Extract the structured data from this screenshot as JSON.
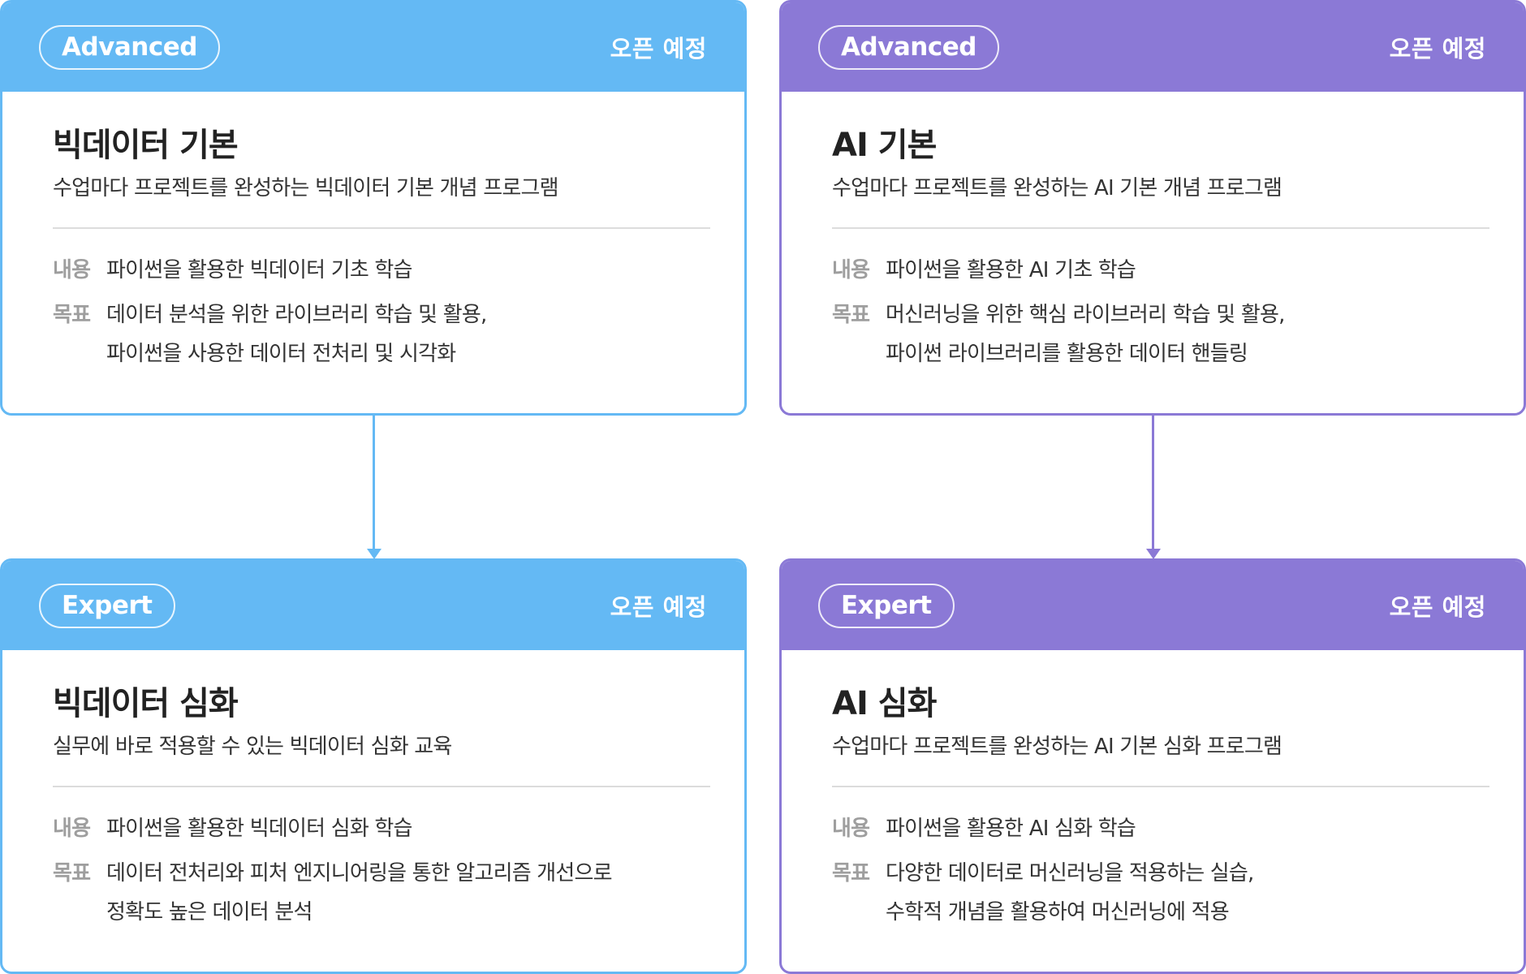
{
  "colors": {
    "bigdata_accent": "#64B9F4",
    "ai_accent": "#8B79D6",
    "label_gray": "#9E9E9E",
    "divider": "#DCDCDC"
  },
  "labels": {
    "content": "내용",
    "goal": "목표"
  },
  "cards": [
    {
      "level": "Advanced",
      "status": "오픈 예정",
      "title": "빅데이터 기본",
      "description": "수업마다 프로젝트를 완성하는 빅데이터 기본 개념 프로그램",
      "content": "파이썬을 활용한 빅데이터 기초 학습",
      "goal_lines": [
        "데이터 분석을 위한 라이브러리 학습 및 활용,",
        "파이썬을 사용한 데이터 전처리 및 시각화"
      ]
    },
    {
      "level": "Advanced",
      "status": "오픈 예정",
      "title": "AI 기본",
      "description": "수업마다 프로젝트를 완성하는 AI 기본 개념 프로그램",
      "content": "파이썬을 활용한 AI 기초 학습",
      "goal_lines": [
        "머신러닝을 위한 핵심 라이브러리 학습 및 활용,",
        "파이썬 라이브러리를 활용한 데이터 핸들링"
      ]
    },
    {
      "level": "Expert",
      "status": "오픈 예정",
      "title": "빅데이터 심화",
      "description": "실무에 바로 적용할 수 있는 빅데이터 심화 교육",
      "content": "파이썬을 활용한 빅데이터 심화 학습",
      "goal_lines": [
        "데이터 전처리와 피처 엔지니어링을 통한 알고리즘 개선으로",
        "정확도 높은 데이터 분석"
      ]
    },
    {
      "level": "Expert",
      "status": "오픈 예정",
      "title": "AI 심화",
      "description": "수업마다 프로젝트를 완성하는 AI 기본 심화 프로그램",
      "content": "파이썬을 활용한 AI 심화 학습",
      "goal_lines": [
        "다양한 데이터로 머신러닝을 적용하는 실습,",
        "수학적 개념을 활용하여 머신러닝에 적용"
      ]
    }
  ]
}
